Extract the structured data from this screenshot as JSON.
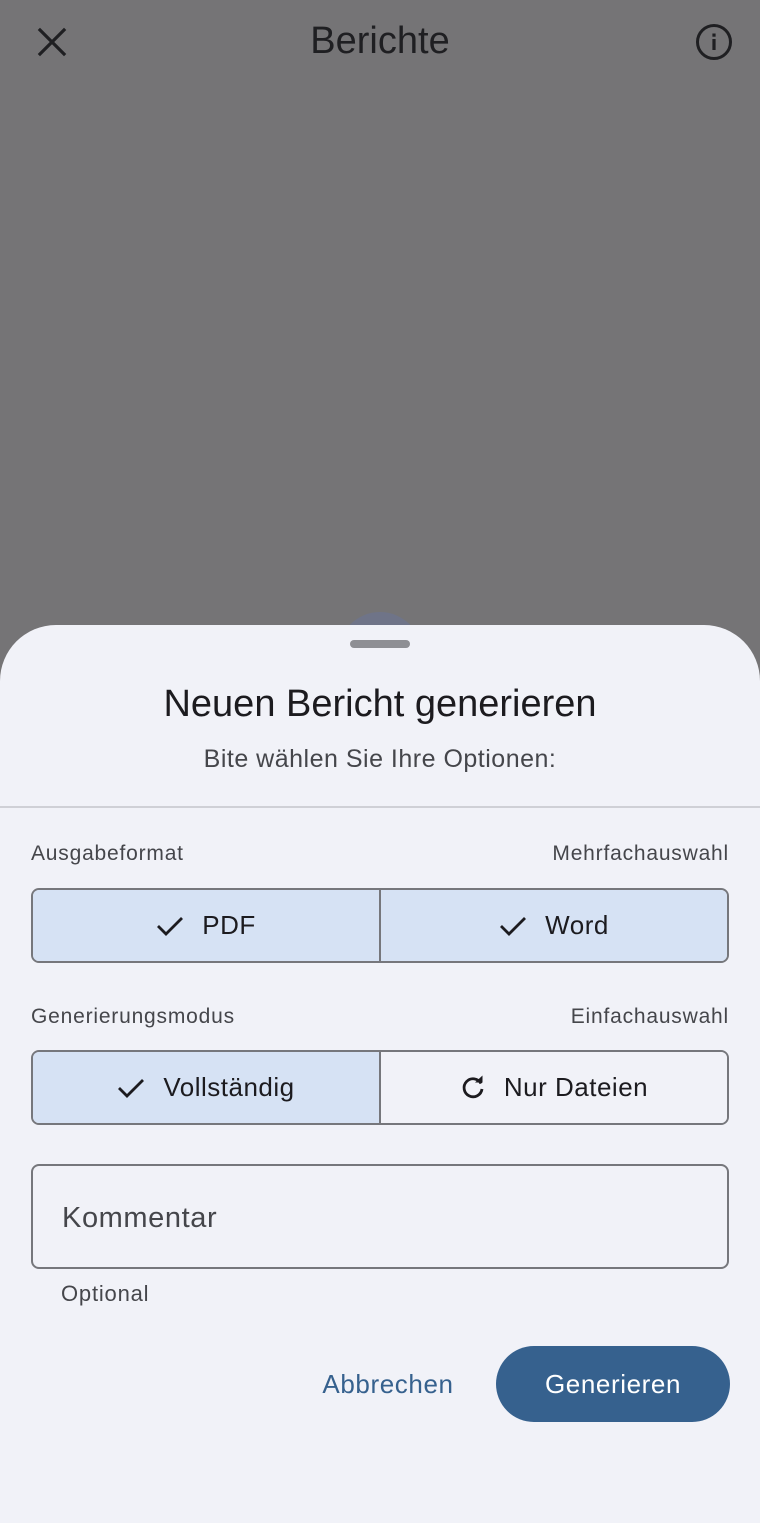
{
  "appbar": {
    "title": "Berichte",
    "close_icon": "close-icon",
    "info_icon": "info-icon"
  },
  "sheet": {
    "title": "Neuen Bericht generieren",
    "subtitle": "Bite wählen Sie Ihre Optionen:",
    "output_format": {
      "label": "Ausgabeformat",
      "hint": "Mehrfachauswahl",
      "options": [
        {
          "label": "PDF",
          "selected": true,
          "icon": "check-icon"
        },
        {
          "label": "Word",
          "selected": true,
          "icon": "check-icon"
        }
      ]
    },
    "generation_mode": {
      "label": "Generierungsmodus",
      "hint": "Einfachauswahl",
      "options": [
        {
          "label": "Vollständig",
          "selected": true,
          "icon": "check-icon"
        },
        {
          "label": "Nur Dateien",
          "selected": false,
          "icon": "refresh-icon"
        }
      ]
    },
    "comment": {
      "placeholder": "Kommentar",
      "helper": "Optional"
    },
    "actions": {
      "cancel": "Abbrechen",
      "generate": "Generieren"
    }
  },
  "colors": {
    "scrim": "#757476",
    "sheet_bg": "#f1f2f8",
    "selected_segment": "#d6e2f4",
    "primary": "#36618e"
  }
}
